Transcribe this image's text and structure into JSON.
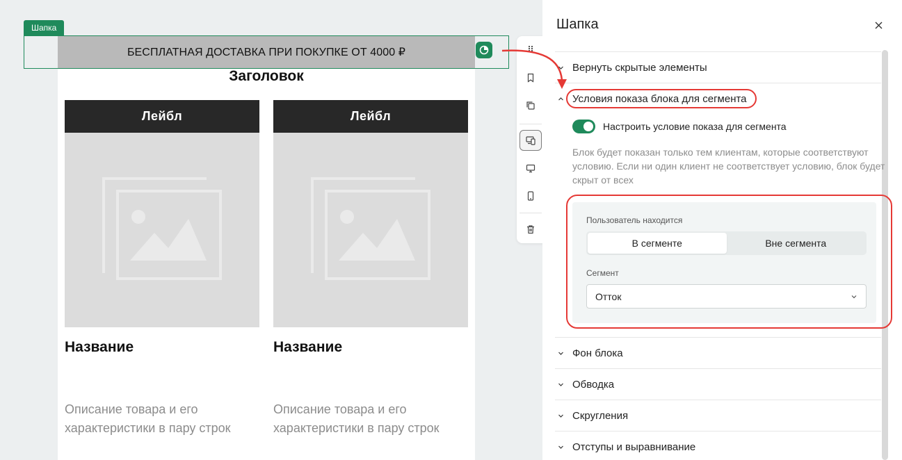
{
  "canvas": {
    "selection_tag": "Шапка",
    "banner_text": "БЕСПЛАТНАЯ ДОСТАВКА ПРИ ПОКУПКЕ ОТ 4000 ₽",
    "email_title": "Заголовок",
    "cards": [
      {
        "label": "Лейбл",
        "name": "Название",
        "description": "Описание товара и его характеристики в пару строк"
      },
      {
        "label": "Лейбл",
        "name": "Название",
        "description": "Описание товара и его характеристики в пару строк"
      }
    ]
  },
  "toolbar": {
    "icons": [
      "drag-handle-icon",
      "bookmark-icon",
      "copy-icon",
      "devices-icon",
      "desktop-icon",
      "mobile-icon",
      "trash-icon"
    ],
    "active": "devices-icon"
  },
  "panel": {
    "title": "Шапка",
    "sections": {
      "restore_hidden": "Вернуть скрытые элементы",
      "segment_conditions": "Условия показа блока для сегмента",
      "background": "Фон блока",
      "border": "Обводка",
      "rounding": "Скругления",
      "padding_alignment": "Отступы и выравнивание"
    },
    "segment": {
      "toggle_label": "Настроить условие показа для сегмента",
      "toggle_on": true,
      "help_text": "Блок будет показан только тем клиентам, которые соответствуют условию. Если ни один клиент не соответствует условию, блок будет скрыт от всех",
      "user_is_label": "Пользователь находится",
      "options": [
        "В сегменте",
        "Вне сегмента"
      ],
      "selected_option": "В сегменте",
      "segment_label": "Сегмент",
      "segment_value": "Отток"
    }
  },
  "colors": {
    "accent_green": "#1f8a5b",
    "annotation_red": "#e53935",
    "banner_gray": "#b9b9b9",
    "label_dark": "#282828"
  }
}
